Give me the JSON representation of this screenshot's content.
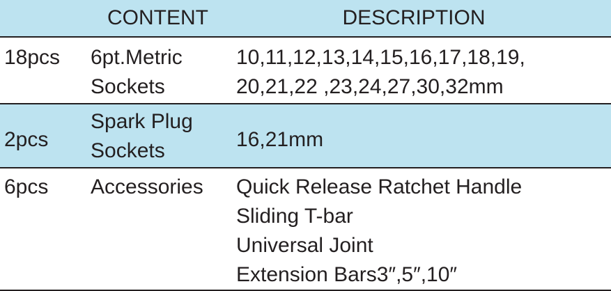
{
  "header": {
    "qty": "",
    "content": "CONTENT",
    "description": "DESCRIPTION"
  },
  "rows": [
    {
      "qty": "18pcs",
      "content": [
        "6pt.Metric",
        "Sockets"
      ],
      "description": [
        "10,11,12,13,14,15,16,17,18,19,",
        "20,21,22 ,23,24,27,30,32mm"
      ]
    },
    {
      "qty": "2pcs",
      "content": [
        "Spark Plug",
        "Sockets"
      ],
      "description": [
        "16,21mm"
      ]
    },
    {
      "qty": "6pcs",
      "content": [
        "Accessories"
      ],
      "description": [
        "Quick Release Ratchet Handle",
        "Sliding T-bar",
        "Universal Joint",
        "Extension Bars3″,5″,10″"
      ]
    }
  ],
  "colors": {
    "header_fill": "#bde3f0",
    "shaded_row_fill": "#bde3f0",
    "text": "#231f20",
    "rule": "#231f20"
  }
}
